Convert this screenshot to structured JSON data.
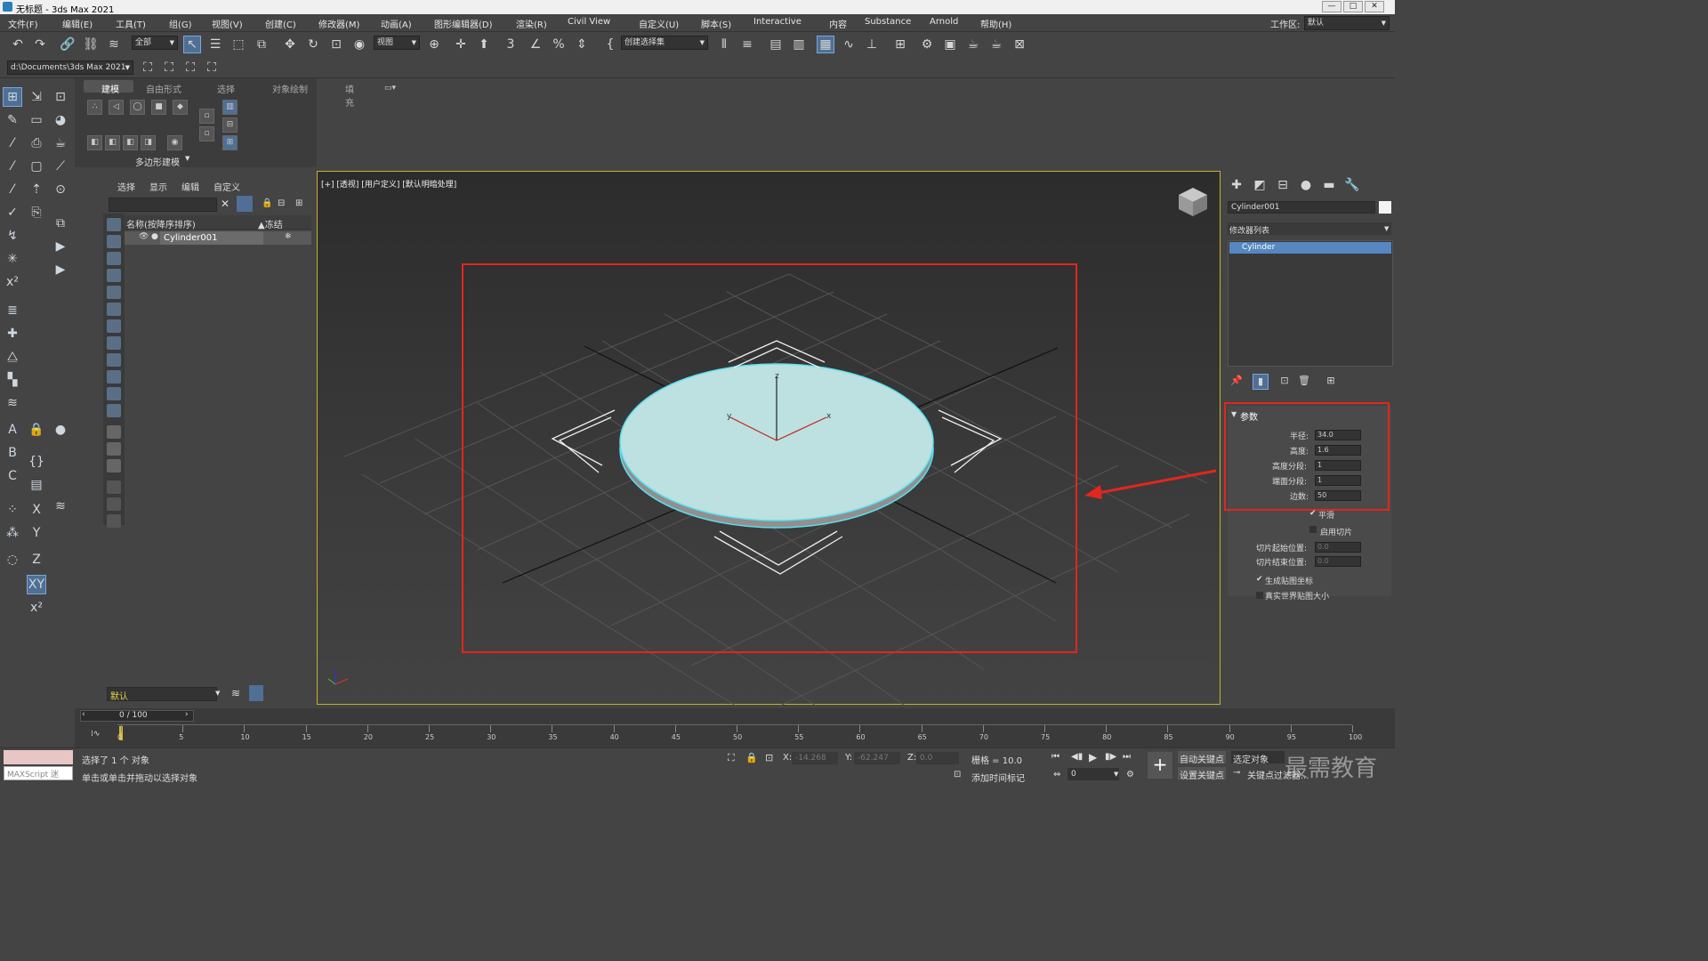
{
  "titlebar": {
    "title": "无标题 - 3ds Max 2021",
    "minimize": "—",
    "maximize": "□",
    "close": "✕"
  },
  "menubar": {
    "items": [
      "文件(F)",
      "编辑(E)",
      "工具(T)",
      "组(G)",
      "视图(V)",
      "创建(C)",
      "修改器(M)",
      "动画(A)",
      "图形编辑器(D)",
      "渲染(R)",
      "Civil View",
      "自定义(U)",
      "脚本(S)",
      "Interactive",
      "内容",
      "Substance",
      "Arnold",
      "帮助(H)"
    ],
    "workspace_label": "工作区:",
    "workspace_value": "默认"
  },
  "toolbar": {
    "filter_value": "全部",
    "ref_coord_value": "视图",
    "selection_set_value": "创建选择集",
    "snap_text": "3",
    "percent_text": "%"
  },
  "toolbar2": {
    "path_value": "d:\\Documents\\3ds Max 2021"
  },
  "ribbon": {
    "tabs": [
      "建模",
      "自由形式",
      "选择",
      "对象绘制",
      "填充"
    ],
    "footer": "多边形建模"
  },
  "scene_explorer": {
    "tabs": [
      "选择",
      "显示",
      "编辑",
      "自定义"
    ],
    "col_name": "名称(按降序排序)",
    "col_frozen": "▲冻结",
    "objects": [
      {
        "name": "Cylinder001"
      }
    ],
    "layer_value": "默认"
  },
  "viewport": {
    "label": "[+] [透视] [用户定义] [默认明暗处理]",
    "gizmo_x": "x",
    "gizmo_y": "y",
    "gizmo_z": "z"
  },
  "command_panel": {
    "object_name": "Cylinder001",
    "modifier_list": "修改器列表",
    "stack": [
      "Cylinder"
    ],
    "rollout_title": "参数",
    "params": [
      {
        "label": "半径:",
        "value": "34.0"
      },
      {
        "label": "高度:",
        "value": "1.6"
      },
      {
        "label": "高度分段:",
        "value": "1"
      },
      {
        "label": "端面分段:",
        "value": "1"
      },
      {
        "label": "边数:",
        "value": "50"
      }
    ],
    "smooth": "平滑",
    "slice_on": "启用切片",
    "slice_from": "切片起始位置:",
    "slice_to": "切片结束位置:",
    "slice_from_value": "0.0",
    "slice_to_value": "0.0",
    "gen_mapping": "生成贴图坐标",
    "real_world": "真实世界贴图大小"
  },
  "timeline": {
    "frame": "0 / 100",
    "ticks": [
      "0",
      "5",
      "10",
      "15",
      "20",
      "25",
      "30",
      "35",
      "40",
      "45",
      "50",
      "55",
      "60",
      "65",
      "70",
      "75",
      "80",
      "85",
      "90",
      "95",
      "100"
    ]
  },
  "status": {
    "maxscript": "MAXScript 迷",
    "selected": "选择了 1 个 对象",
    "hint": "单击或单击并拖动以选择对象",
    "x_label": "X:",
    "x_value": "-14.268",
    "y_label": "Y:",
    "y_value": "-62.247",
    "z_label": "Z:",
    "z_value": "0.0",
    "grid": "栅格 = 10.0",
    "add_time_tag": "添加时间标记",
    "auto_key": "自动关键点",
    "set_key": "设置关键点",
    "selected_obj": "选定对象",
    "key_filters": "关键点过滤器...",
    "frame_value": "0",
    "watermark": "最需教育"
  }
}
